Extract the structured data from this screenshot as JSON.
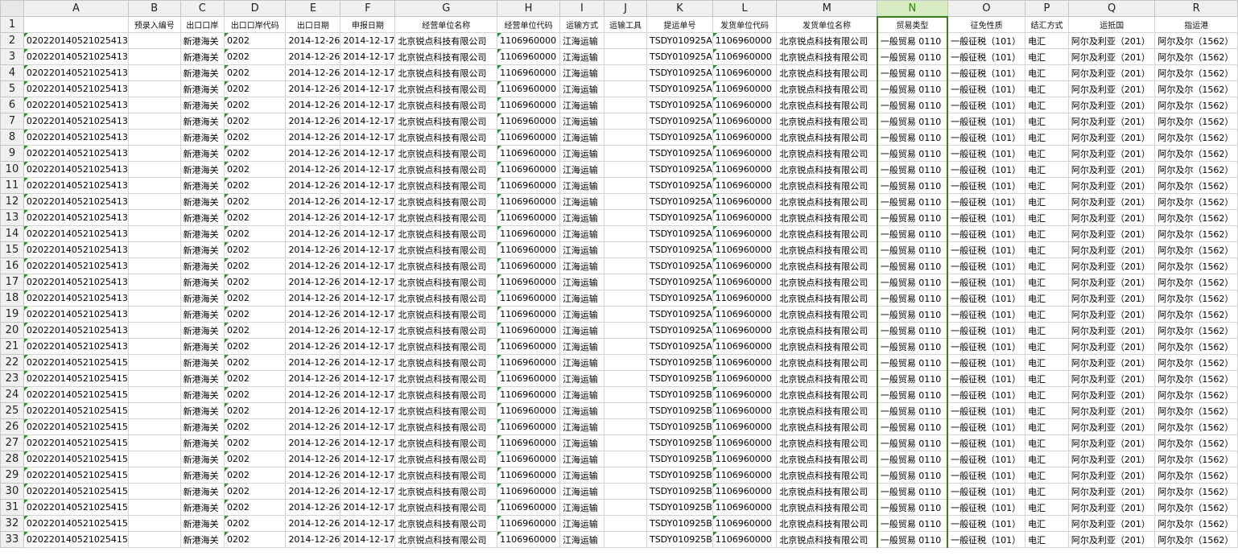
{
  "sheet": {
    "col_letters": [
      "A",
      "B",
      "C",
      "D",
      "E",
      "F",
      "G",
      "H",
      "I",
      "J",
      "K",
      "L",
      "M",
      "N",
      "O",
      "P",
      "Q",
      "R"
    ],
    "selected_column": "N",
    "header_row": [
      "",
      "预录入编号",
      "出口口岸",
      "出口口岸代码",
      "出口日期",
      "申报日期",
      "经营单位名称",
      "经营单位代码",
      "运输方式",
      "运输工具",
      "提运单号",
      "发货单位代码",
      "发货单位名称",
      "贸易类型",
      "征免性质",
      "结汇方式",
      "运抵国",
      "指运港"
    ],
    "rows": [
      {
        "n": "2",
        "c": [
          "020220140521025413",
          "",
          "新港海关",
          "0202",
          "2014-12-26",
          "2014-12-17",
          "北京锐点科技有限公司",
          "1106960000",
          "江海运输",
          "",
          "TSDY010925A",
          "1106960000",
          "北京锐点科技有限公司",
          "一般贸易 0110",
          "一般征税（101）",
          "电汇",
          "阿尔及利亚（201）",
          "阿尔及尔（1562）"
        ]
      },
      {
        "n": "3",
        "c": [
          "020220140521025413",
          "",
          "新港海关",
          "0202",
          "2014-12-26",
          "2014-12-17",
          "北京锐点科技有限公司",
          "1106960000",
          "江海运输",
          "",
          "TSDY010925A",
          "1106960000",
          "北京锐点科技有限公司",
          "一般贸易 0110",
          "一般征税（101）",
          "电汇",
          "阿尔及利亚（201）",
          "阿尔及尔（1562）"
        ]
      },
      {
        "n": "4",
        "c": [
          "020220140521025413",
          "",
          "新港海关",
          "0202",
          "2014-12-26",
          "2014-12-17",
          "北京锐点科技有限公司",
          "1106960000",
          "江海运输",
          "",
          "TSDY010925A",
          "1106960000",
          "北京锐点科技有限公司",
          "一般贸易 0110",
          "一般征税（101）",
          "电汇",
          "阿尔及利亚（201）",
          "阿尔及尔（1562）"
        ]
      },
      {
        "n": "5",
        "c": [
          "020220140521025413",
          "",
          "新港海关",
          "0202",
          "2014-12-26",
          "2014-12-17",
          "北京锐点科技有限公司",
          "1106960000",
          "江海运输",
          "",
          "TSDY010925A",
          "1106960000",
          "北京锐点科技有限公司",
          "一般贸易 0110",
          "一般征税（101）",
          "电汇",
          "阿尔及利亚（201）",
          "阿尔及尔（1562）"
        ]
      },
      {
        "n": "6",
        "c": [
          "020220140521025413",
          "",
          "新港海关",
          "0202",
          "2014-12-26",
          "2014-12-17",
          "北京锐点科技有限公司",
          "1106960000",
          "江海运输",
          "",
          "TSDY010925A",
          "1106960000",
          "北京锐点科技有限公司",
          "一般贸易 0110",
          "一般征税（101）",
          "电汇",
          "阿尔及利亚（201）",
          "阿尔及尔（1562）"
        ]
      },
      {
        "n": "7",
        "c": [
          "020220140521025413",
          "",
          "新港海关",
          "0202",
          "2014-12-26",
          "2014-12-17",
          "北京锐点科技有限公司",
          "1106960000",
          "江海运输",
          "",
          "TSDY010925A",
          "1106960000",
          "北京锐点科技有限公司",
          "一般贸易 0110",
          "一般征税（101）",
          "电汇",
          "阿尔及利亚（201）",
          "阿尔及尔（1562）"
        ]
      },
      {
        "n": "8",
        "c": [
          "020220140521025413",
          "",
          "新港海关",
          "0202",
          "2014-12-26",
          "2014-12-17",
          "北京锐点科技有限公司",
          "1106960000",
          "江海运输",
          "",
          "TSDY010925A",
          "1106960000",
          "北京锐点科技有限公司",
          "一般贸易 0110",
          "一般征税（101）",
          "电汇",
          "阿尔及利亚（201）",
          "阿尔及尔（1562）"
        ]
      },
      {
        "n": "9",
        "c": [
          "020220140521025413",
          "",
          "新港海关",
          "0202",
          "2014-12-26",
          "2014-12-17",
          "北京锐点科技有限公司",
          "1106960000",
          "江海运输",
          "",
          "TSDY010925A",
          "1106960000",
          "北京锐点科技有限公司",
          "一般贸易 0110",
          "一般征税（101）",
          "电汇",
          "阿尔及利亚（201）",
          "阿尔及尔（1562）"
        ]
      },
      {
        "n": "10",
        "c": [
          "020220140521025413",
          "",
          "新港海关",
          "0202",
          "2014-12-26",
          "2014-12-17",
          "北京锐点科技有限公司",
          "1106960000",
          "江海运输",
          "",
          "TSDY010925A",
          "1106960000",
          "北京锐点科技有限公司",
          "一般贸易 0110",
          "一般征税（101）",
          "电汇",
          "阿尔及利亚（201）",
          "阿尔及尔（1562）"
        ]
      },
      {
        "n": "11",
        "c": [
          "020220140521025413",
          "",
          "新港海关",
          "0202",
          "2014-12-26",
          "2014-12-17",
          "北京锐点科技有限公司",
          "1106960000",
          "江海运输",
          "",
          "TSDY010925A",
          "1106960000",
          "北京锐点科技有限公司",
          "一般贸易 0110",
          "一般征税（101）",
          "电汇",
          "阿尔及利亚（201）",
          "阿尔及尔（1562）"
        ]
      },
      {
        "n": "12",
        "c": [
          "020220140521025413",
          "",
          "新港海关",
          "0202",
          "2014-12-26",
          "2014-12-17",
          "北京锐点科技有限公司",
          "1106960000",
          "江海运输",
          "",
          "TSDY010925A",
          "1106960000",
          "北京锐点科技有限公司",
          "一般贸易 0110",
          "一般征税（101）",
          "电汇",
          "阿尔及利亚（201）",
          "阿尔及尔（1562）"
        ]
      },
      {
        "n": "13",
        "c": [
          "020220140521025413",
          "",
          "新港海关",
          "0202",
          "2014-12-26",
          "2014-12-17",
          "北京锐点科技有限公司",
          "1106960000",
          "江海运输",
          "",
          "TSDY010925A",
          "1106960000",
          "北京锐点科技有限公司",
          "一般贸易 0110",
          "一般征税（101）",
          "电汇",
          "阿尔及利亚（201）",
          "阿尔及尔（1562）"
        ]
      },
      {
        "n": "14",
        "c": [
          "020220140521025413",
          "",
          "新港海关",
          "0202",
          "2014-12-26",
          "2014-12-17",
          "北京锐点科技有限公司",
          "1106960000",
          "江海运输",
          "",
          "TSDY010925A",
          "1106960000",
          "北京锐点科技有限公司",
          "一般贸易 0110",
          "一般征税（101）",
          "电汇",
          "阿尔及利亚（201）",
          "阿尔及尔（1562）"
        ]
      },
      {
        "n": "15",
        "c": [
          "020220140521025413",
          "",
          "新港海关",
          "0202",
          "2014-12-26",
          "2014-12-17",
          "北京锐点科技有限公司",
          "1106960000",
          "江海运输",
          "",
          "TSDY010925A",
          "1106960000",
          "北京锐点科技有限公司",
          "一般贸易 0110",
          "一般征税（101）",
          "电汇",
          "阿尔及利亚（201）",
          "阿尔及尔（1562）"
        ]
      },
      {
        "n": "16",
        "c": [
          "020220140521025413",
          "",
          "新港海关",
          "0202",
          "2014-12-26",
          "2014-12-17",
          "北京锐点科技有限公司",
          "1106960000",
          "江海运输",
          "",
          "TSDY010925A",
          "1106960000",
          "北京锐点科技有限公司",
          "一般贸易 0110",
          "一般征税（101）",
          "电汇",
          "阿尔及利亚（201）",
          "阿尔及尔（1562）"
        ]
      },
      {
        "n": "17",
        "c": [
          "020220140521025413",
          "",
          "新港海关",
          "0202",
          "2014-12-26",
          "2014-12-17",
          "北京锐点科技有限公司",
          "1106960000",
          "江海运输",
          "",
          "TSDY010925A",
          "1106960000",
          "北京锐点科技有限公司",
          "一般贸易 0110",
          "一般征税（101）",
          "电汇",
          "阿尔及利亚（201）",
          "阿尔及尔（1562）"
        ]
      },
      {
        "n": "18",
        "c": [
          "020220140521025413",
          "",
          "新港海关",
          "0202",
          "2014-12-26",
          "2014-12-17",
          "北京锐点科技有限公司",
          "1106960000",
          "江海运输",
          "",
          "TSDY010925A",
          "1106960000",
          "北京锐点科技有限公司",
          "一般贸易 0110",
          "一般征税（101）",
          "电汇",
          "阿尔及利亚（201）",
          "阿尔及尔（1562）"
        ]
      },
      {
        "n": "19",
        "c": [
          "020220140521025413",
          "",
          "新港海关",
          "0202",
          "2014-12-26",
          "2014-12-17",
          "北京锐点科技有限公司",
          "1106960000",
          "江海运输",
          "",
          "TSDY010925A",
          "1106960000",
          "北京锐点科技有限公司",
          "一般贸易 0110",
          "一般征税（101）",
          "电汇",
          "阿尔及利亚（201）",
          "阿尔及尔（1562）"
        ]
      },
      {
        "n": "20",
        "c": [
          "020220140521025413",
          "",
          "新港海关",
          "0202",
          "2014-12-26",
          "2014-12-17",
          "北京锐点科技有限公司",
          "1106960000",
          "江海运输",
          "",
          "TSDY010925A",
          "1106960000",
          "北京锐点科技有限公司",
          "一般贸易 0110",
          "一般征税（101）",
          "电汇",
          "阿尔及利亚（201）",
          "阿尔及尔（1562）"
        ]
      },
      {
        "n": "21",
        "c": [
          "020220140521025413",
          "",
          "新港海关",
          "0202",
          "2014-12-26",
          "2014-12-17",
          "北京锐点科技有限公司",
          "1106960000",
          "江海运输",
          "",
          "TSDY010925A",
          "1106960000",
          "北京锐点科技有限公司",
          "一般贸易 0110",
          "一般征税（101）",
          "电汇",
          "阿尔及利亚（201）",
          "阿尔及尔（1562）"
        ]
      },
      {
        "n": "22",
        "c": [
          "020220140521025415",
          "",
          "新港海关",
          "0202",
          "2014-12-26",
          "2014-12-17",
          "北京锐点科技有限公司",
          "1106960000",
          "江海运输",
          "",
          "TSDY010925B",
          "1106960000",
          "北京锐点科技有限公司",
          "一般贸易 0110",
          "一般征税（101）",
          "电汇",
          "阿尔及利亚（201）",
          "阿尔及尔（1562）"
        ]
      },
      {
        "n": "23",
        "c": [
          "020220140521025415",
          "",
          "新港海关",
          "0202",
          "2014-12-26",
          "2014-12-17",
          "北京锐点科技有限公司",
          "1106960000",
          "江海运输",
          "",
          "TSDY010925B",
          "1106960000",
          "北京锐点科技有限公司",
          "一般贸易 0110",
          "一般征税（101）",
          "电汇",
          "阿尔及利亚（201）",
          "阿尔及尔（1562）"
        ]
      },
      {
        "n": "24",
        "c": [
          "020220140521025415",
          "",
          "新港海关",
          "0202",
          "2014-12-26",
          "2014-12-17",
          "北京锐点科技有限公司",
          "1106960000",
          "江海运输",
          "",
          "TSDY010925B",
          "1106960000",
          "北京锐点科技有限公司",
          "一般贸易 0110",
          "一般征税（101）",
          "电汇",
          "阿尔及利亚（201）",
          "阿尔及尔（1562）"
        ]
      },
      {
        "n": "25",
        "c": [
          "020220140521025415",
          "",
          "新港海关",
          "0202",
          "2014-12-26",
          "2014-12-17",
          "北京锐点科技有限公司",
          "1106960000",
          "江海运输",
          "",
          "TSDY010925B",
          "1106960000",
          "北京锐点科技有限公司",
          "一般贸易 0110",
          "一般征税（101）",
          "电汇",
          "阿尔及利亚（201）",
          "阿尔及尔（1562）"
        ]
      },
      {
        "n": "26",
        "c": [
          "020220140521025415",
          "",
          "新港海关",
          "0202",
          "2014-12-26",
          "2014-12-17",
          "北京锐点科技有限公司",
          "1106960000",
          "江海运输",
          "",
          "TSDY010925B",
          "1106960000",
          "北京锐点科技有限公司",
          "一般贸易 0110",
          "一般征税（101）",
          "电汇",
          "阿尔及利亚（201）",
          "阿尔及尔（1562）"
        ]
      },
      {
        "n": "27",
        "c": [
          "020220140521025415",
          "",
          "新港海关",
          "0202",
          "2014-12-26",
          "2014-12-17",
          "北京锐点科技有限公司",
          "1106960000",
          "江海运输",
          "",
          "TSDY010925B",
          "1106960000",
          "北京锐点科技有限公司",
          "一般贸易 0110",
          "一般征税（101）",
          "电汇",
          "阿尔及利亚（201）",
          "阿尔及尔（1562）"
        ]
      },
      {
        "n": "28",
        "c": [
          "020220140521025415",
          "",
          "新港海关",
          "0202",
          "2014-12-26",
          "2014-12-17",
          "北京锐点科技有限公司",
          "1106960000",
          "江海运输",
          "",
          "TSDY010925B",
          "1106960000",
          "北京锐点科技有限公司",
          "一般贸易 0110",
          "一般征税（101）",
          "电汇",
          "阿尔及利亚（201）",
          "阿尔及尔（1562）"
        ]
      },
      {
        "n": "29",
        "c": [
          "020220140521025415",
          "",
          "新港海关",
          "0202",
          "2014-12-26",
          "2014-12-17",
          "北京锐点科技有限公司",
          "1106960000",
          "江海运输",
          "",
          "TSDY010925B",
          "1106960000",
          "北京锐点科技有限公司",
          "一般贸易 0110",
          "一般征税（101）",
          "电汇",
          "阿尔及利亚（201）",
          "阿尔及尔（1562）"
        ]
      },
      {
        "n": "30",
        "c": [
          "020220140521025415",
          "",
          "新港海关",
          "0202",
          "2014-12-26",
          "2014-12-17",
          "北京锐点科技有限公司",
          "1106960000",
          "江海运输",
          "",
          "TSDY010925B",
          "1106960000",
          "北京锐点科技有限公司",
          "一般贸易 0110",
          "一般征税（101）",
          "电汇",
          "阿尔及利亚（201）",
          "阿尔及尔（1562）"
        ]
      },
      {
        "n": "31",
        "c": [
          "020220140521025415",
          "",
          "新港海关",
          "0202",
          "2014-12-26",
          "2014-12-17",
          "北京锐点科技有限公司",
          "1106960000",
          "江海运输",
          "",
          "TSDY010925B",
          "1106960000",
          "北京锐点科技有限公司",
          "一般贸易 0110",
          "一般征税（101）",
          "电汇",
          "阿尔及利亚（201）",
          "阿尔及尔（1562）"
        ]
      },
      {
        "n": "32",
        "c": [
          "020220140521025415",
          "",
          "新港海关",
          "0202",
          "2014-12-26",
          "2014-12-17",
          "北京锐点科技有限公司",
          "1106960000",
          "江海运输",
          "",
          "TSDY010925B",
          "1106960000",
          "北京锐点科技有限公司",
          "一般贸易 0110",
          "一般征税（101）",
          "电汇",
          "阿尔及利亚（201）",
          "阿尔及尔（1562）"
        ]
      },
      {
        "n": "33",
        "c": [
          "020220140521025415",
          "",
          "新港海关",
          "0202",
          "2014-12-26",
          "2014-12-17",
          "北京锐点科技有限公司",
          "1106960000",
          "江海运输",
          "",
          "TSDY010925B",
          "1106960000",
          "北京锐点科技有限公司",
          "一般贸易 0110",
          "一般征税（101）",
          "电汇",
          "阿尔及利亚（201）",
          "阿尔及尔（1562）"
        ]
      }
    ]
  }
}
